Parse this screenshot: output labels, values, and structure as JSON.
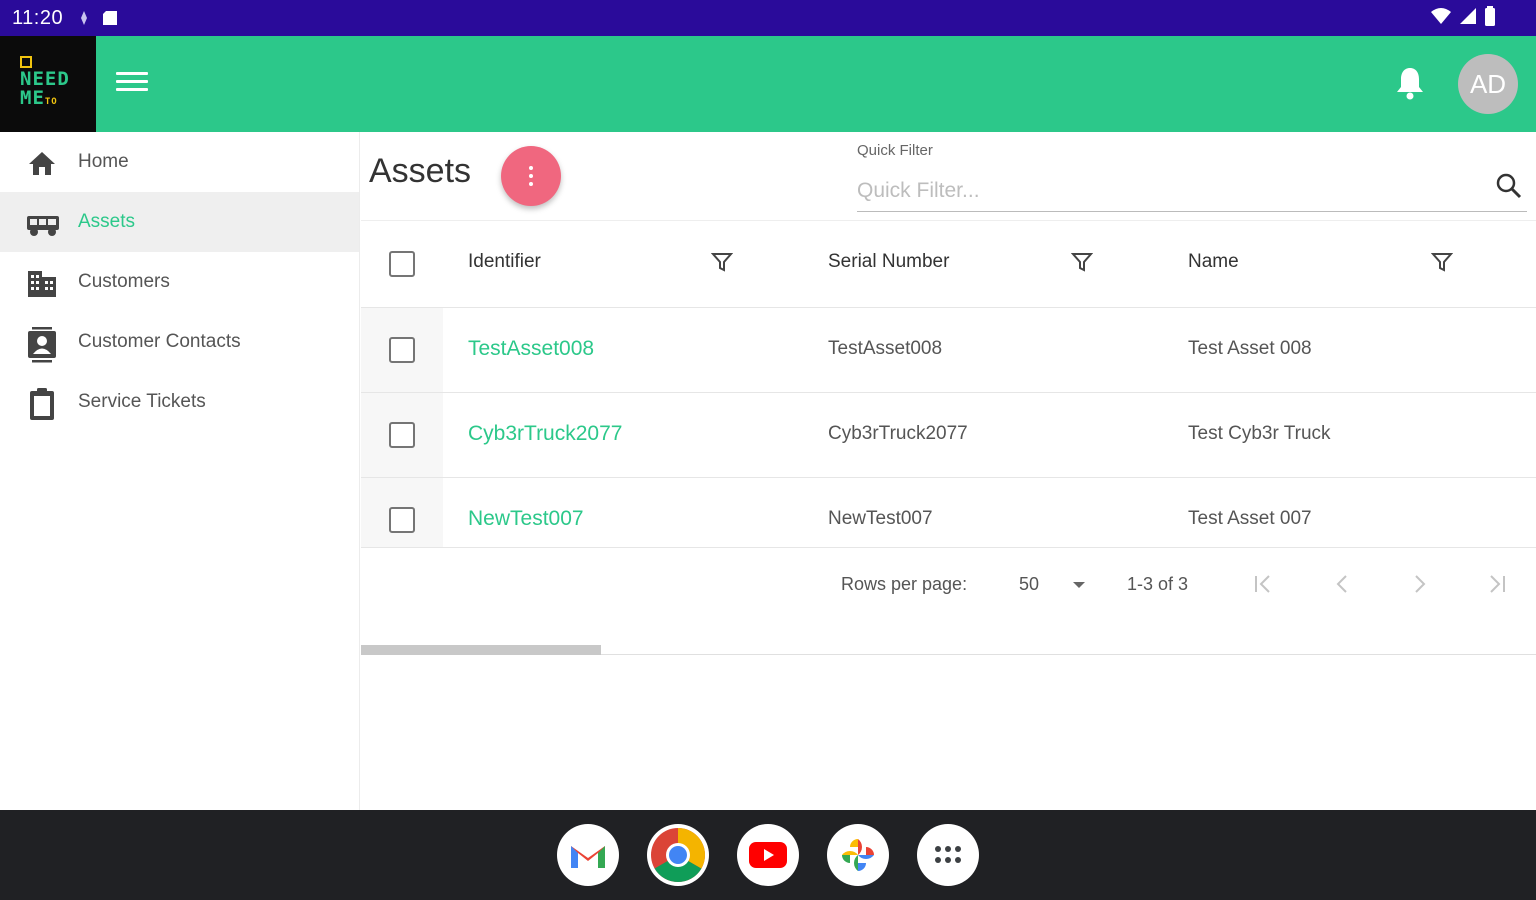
{
  "status_bar": {
    "time": "11:20"
  },
  "app": {
    "logo_line1": "NEED",
    "logo_line2": "ME",
    "logo_small": "TO",
    "avatar_initials": "AD",
    "brand_color": "#2cc88a"
  },
  "sidebar": {
    "items": [
      {
        "label": "Home",
        "icon": "home-icon",
        "active": false
      },
      {
        "label": "Assets",
        "icon": "truck-icon",
        "active": true
      },
      {
        "label": "Customers",
        "icon": "building-icon",
        "active": false
      },
      {
        "label": "Customer Contacts",
        "icon": "contacts-icon",
        "active": false
      },
      {
        "label": "Service Tickets",
        "icon": "clipboard-icon",
        "active": false
      }
    ]
  },
  "main": {
    "title": "Assets",
    "quick_filter": {
      "label": "Quick Filter",
      "placeholder": "Quick Filter...",
      "value": ""
    },
    "table": {
      "columns": [
        "Identifier",
        "Serial Number",
        "Name"
      ],
      "rows": [
        {
          "identifier": "TestAsset008",
          "serial": "TestAsset008",
          "name": "Test Asset 008"
        },
        {
          "identifier": "Cyb3rTruck2077",
          "serial": "Cyb3rTruck2077",
          "name": "Test Cyb3r Truck"
        },
        {
          "identifier": "NewTest007",
          "serial": "NewTest007",
          "name": "Test Asset 007"
        }
      ]
    },
    "pagination": {
      "rows_label": "Rows per page:",
      "rows_value": "50",
      "range": "1-3 of 3"
    }
  },
  "dock": [
    "gmail-icon",
    "chrome-icon",
    "youtube-icon",
    "photos-icon",
    "app-launcher-icon"
  ]
}
